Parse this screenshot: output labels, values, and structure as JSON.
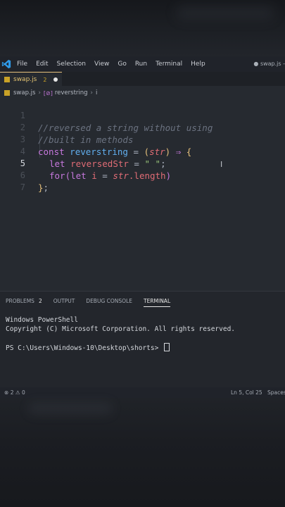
{
  "menubar": {
    "items": [
      "File",
      "Edit",
      "Selection",
      "View",
      "Go",
      "Run",
      "Terminal",
      "Help"
    ],
    "window_title": "● swap.js -"
  },
  "tab": {
    "filename": "swap.js",
    "problems": "2"
  },
  "breadcrumb": {
    "file": "swap.js",
    "symbol": "reverstring",
    "trailing": "i"
  },
  "editor": {
    "line_numbers": [
      "1",
      "2",
      "3",
      "4",
      "5",
      "6",
      "7"
    ],
    "active_line": "5",
    "code": {
      "l1": "//reversed a string without using",
      "l2": "//built in methods",
      "l3_kw": "const",
      "l3_fn": "reverstring",
      "l3_eq": " = ",
      "l3_open": "(",
      "l3_param": "str",
      "l3_close": ")",
      "l3_arrow": " ⇒ ",
      "l3_brace": "{",
      "l4_kw": "let",
      "l4_var": "reversedStr",
      "l4_eq": " = ",
      "l4_str": "\" \"",
      "l4_semi": ";",
      "l5_kw": "for",
      "l5_open": "(",
      "l5_let": "let",
      "l5_i": " i",
      "l5_eq": " = ",
      "l5_str": "str",
      "l5_dot": ".length",
      "l5_close": ")",
      "l6_brace": "}",
      "l6_semi": ";"
    }
  },
  "panel": {
    "tabs": [
      "PROBLEMS",
      "OUTPUT",
      "DEBUG CONSOLE",
      "TERMINAL"
    ],
    "problems_count": "2",
    "active_tab": "TERMINAL",
    "terminal_lines": [
      "Windows PowerShell",
      "Copyright (C) Microsoft Corporation. All rights reserved.",
      "",
      "PS C:\\Users\\Windows-10\\Desktop\\shorts> "
    ]
  },
  "statusbar": {
    "errors": "2",
    "warnings": "0",
    "cursor_position": "Ln 5, Col 25",
    "indent": "Spaces"
  },
  "colors": {
    "accent": "#e5c07b",
    "keyword": "#c678dd",
    "function": "#61afef",
    "variable": "#e06c75",
    "string": "#98c379"
  }
}
